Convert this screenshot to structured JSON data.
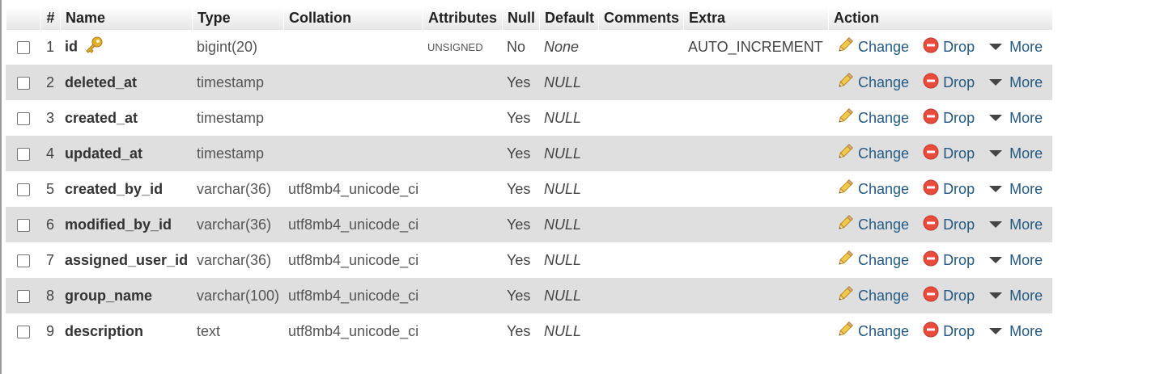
{
  "columns_header": {
    "num": "#",
    "name": "Name",
    "type": "Type",
    "collation": "Collation",
    "attributes": "Attributes",
    "null": "Null",
    "default": "Default",
    "comments": "Comments",
    "extra": "Extra",
    "action": "Action"
  },
  "actions": {
    "change": "Change",
    "drop": "Drop",
    "more": "More"
  },
  "rows": [
    {
      "num": "1",
      "name": "id",
      "type": "bigint(20)",
      "collation": "",
      "attributes": "UNSIGNED",
      "null": "No",
      "default": "None",
      "comments": "",
      "extra": "AUTO_INCREMENT",
      "primary_key": true
    },
    {
      "num": "2",
      "name": "deleted_at",
      "type": "timestamp",
      "collation": "",
      "attributes": "",
      "null": "Yes",
      "default": "NULL",
      "comments": "",
      "extra": ""
    },
    {
      "num": "3",
      "name": "created_at",
      "type": "timestamp",
      "collation": "",
      "attributes": "",
      "null": "Yes",
      "default": "NULL",
      "comments": "",
      "extra": ""
    },
    {
      "num": "4",
      "name": "updated_at",
      "type": "timestamp",
      "collation": "",
      "attributes": "",
      "null": "Yes",
      "default": "NULL",
      "comments": "",
      "extra": ""
    },
    {
      "num": "5",
      "name": "created_by_id",
      "type": "varchar(36)",
      "collation": "utf8mb4_unicode_ci",
      "attributes": "",
      "null": "Yes",
      "default": "NULL",
      "comments": "",
      "extra": ""
    },
    {
      "num": "6",
      "name": "modified_by_id",
      "type": "varchar(36)",
      "collation": "utf8mb4_unicode_ci",
      "attributes": "",
      "null": "Yes",
      "default": "NULL",
      "comments": "",
      "extra": ""
    },
    {
      "num": "7",
      "name": "assigned_user_id",
      "type": "varchar(36)",
      "collation": "utf8mb4_unicode_ci",
      "attributes": "",
      "null": "Yes",
      "default": "NULL",
      "comments": "",
      "extra": ""
    },
    {
      "num": "8",
      "name": "group_name",
      "type": "varchar(100)",
      "collation": "utf8mb4_unicode_ci",
      "attributes": "",
      "null": "Yes",
      "default": "NULL",
      "comments": "",
      "extra": ""
    },
    {
      "num": "9",
      "name": "description",
      "type": "text",
      "collation": "utf8mb4_unicode_ci",
      "attributes": "",
      "null": "Yes",
      "default": "NULL",
      "comments": "",
      "extra": ""
    }
  ],
  "icons": {
    "primary_key": "key-icon",
    "change": "pencil-icon",
    "drop": "drop-circle-icon",
    "more": "triangle-down-icon"
  },
  "colors": {
    "link": "#235a81",
    "row_alt": "#dfdfdf",
    "drop_icon": "#e94b3c",
    "key_icon": "#e0b030"
  }
}
